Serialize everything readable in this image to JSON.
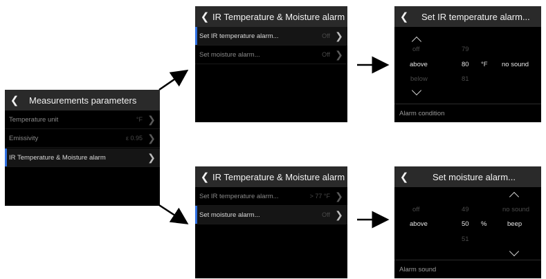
{
  "main_screen": {
    "title": "Measurements parameters",
    "items": [
      {
        "label": "Temperature unit",
        "value": "°F"
      },
      {
        "label": "Emissivity",
        "value": "ε 0.95"
      },
      {
        "label": "IR Temperature & Moisture alarm",
        "value": ""
      }
    ]
  },
  "alarm_screen_top": {
    "title": "IR Temperature & Moisture alarm",
    "items": [
      {
        "label": "Set IR temperature alarm...",
        "value": "Off"
      },
      {
        "label": "Set moisture alarm...",
        "value": "Off"
      }
    ]
  },
  "alarm_screen_bottom": {
    "title": "IR Temperature & Moisture alarm",
    "items": [
      {
        "label": "Set IR temperature alarm...",
        "value": "> 77 °F"
      },
      {
        "label": "Set moisture alarm...",
        "value": "Off"
      }
    ]
  },
  "ir_alarm_screen": {
    "title": "Set IR temperature alarm...",
    "condition_options": [
      "off",
      "above",
      "below"
    ],
    "value_options": [
      "79",
      "80",
      "81"
    ],
    "unit": "°F",
    "sound": "no sound",
    "footer": "Alarm condition"
  },
  "moisture_alarm_screen": {
    "title": "Set moisture alarm...",
    "condition_options": [
      "off",
      "above"
    ],
    "value_options": [
      "49",
      "50",
      "51"
    ],
    "unit": "%",
    "sound_options": [
      "no sound",
      "beep"
    ],
    "footer": "Alarm sound"
  },
  "colors": {
    "screen_bg": "#000000",
    "header_bg": "#2a2a2a",
    "accent": "#2f6fe0"
  }
}
